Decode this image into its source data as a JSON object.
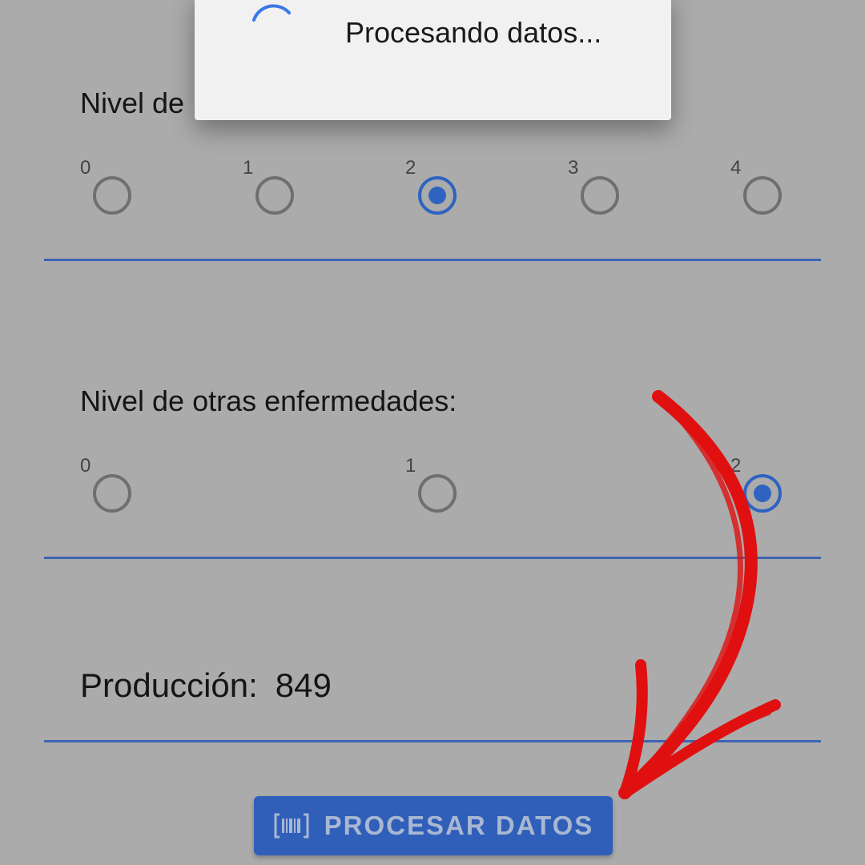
{
  "dialog": {
    "message": "Procesando datos..."
  },
  "section1": {
    "label": "Nivel de",
    "options": [
      "0",
      "1",
      "2",
      "3",
      "4"
    ],
    "selected": "2"
  },
  "section2": {
    "label": "Nivel de otras enfermedades:",
    "options": [
      "0",
      "1",
      "2"
    ],
    "selected": "2"
  },
  "production": {
    "label": "Producción:",
    "value": "849"
  },
  "button": {
    "label": "PROCESAR DATOS",
    "icon": "barcode-icon"
  },
  "colors": {
    "accent": "#2f63c0",
    "background": "#ababab",
    "annotation": "#e01010"
  }
}
